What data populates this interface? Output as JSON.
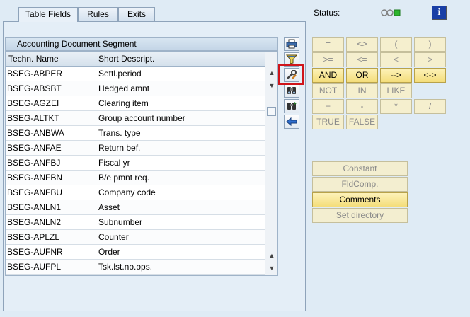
{
  "tabs": [
    {
      "label": "Table Fields"
    },
    {
      "label": "Rules"
    },
    {
      "label": "Exits"
    }
  ],
  "table": {
    "title": "Accounting Document Segment",
    "columns": [
      "Techn. Name",
      "Short Descript."
    ],
    "rows": [
      {
        "name": "BSEG-ABPER",
        "desc": "Settl.period"
      },
      {
        "name": "BSEG-ABSBT",
        "desc": "Hedged amnt"
      },
      {
        "name": "BSEG-AGZEI",
        "desc": "Clearing item"
      },
      {
        "name": "BSEG-ALTKT",
        "desc": "Group account number"
      },
      {
        "name": "BSEG-ANBWA",
        "desc": "Trans. type"
      },
      {
        "name": "BSEG-ANFAE",
        "desc": "Return bef."
      },
      {
        "name": "BSEG-ANFBJ",
        "desc": "Fiscal yr"
      },
      {
        "name": "BSEG-ANFBN",
        "desc": "B/e pmnt req."
      },
      {
        "name": "BSEG-ANFBU",
        "desc": "Company code"
      },
      {
        "name": "BSEG-ANLN1",
        "desc": "Asset"
      },
      {
        "name": "BSEG-ANLN2",
        "desc": "Subnumber"
      },
      {
        "name": "BSEG-APLZL",
        "desc": "Counter"
      },
      {
        "name": "BSEG-AUFNR",
        "desc": "Order"
      },
      {
        "name": "BSEG-AUFPL",
        "desc": "Tsk.lst.no.ops."
      }
    ]
  },
  "status": {
    "label": "Status:",
    "lights": [
      "#808080",
      "#808080",
      "#2db52d"
    ],
    "info": "i"
  },
  "operators": {
    "eq": "=",
    "ne": "<>",
    "lparen": "(",
    "rparen": ")",
    "ge": ">=",
    "le": "<=",
    "lt": "<",
    "gt": ">",
    "and": "AND",
    "or": "OR",
    "implies": "-->",
    "equiv": "<->",
    "not": "NOT",
    "in": "IN",
    "like": "LIKE",
    "plus": "+",
    "minus": "-",
    "mult": "*",
    "div": "/",
    "true": "TRUE",
    "false": "FALSE"
  },
  "actions": {
    "constant": "Constant",
    "fldcomp": "FldComp.",
    "comments": "Comments",
    "setdir": "Set directory"
  },
  "colors": {
    "highlight": "#d0141a",
    "active_button": "#f4dd7a"
  }
}
